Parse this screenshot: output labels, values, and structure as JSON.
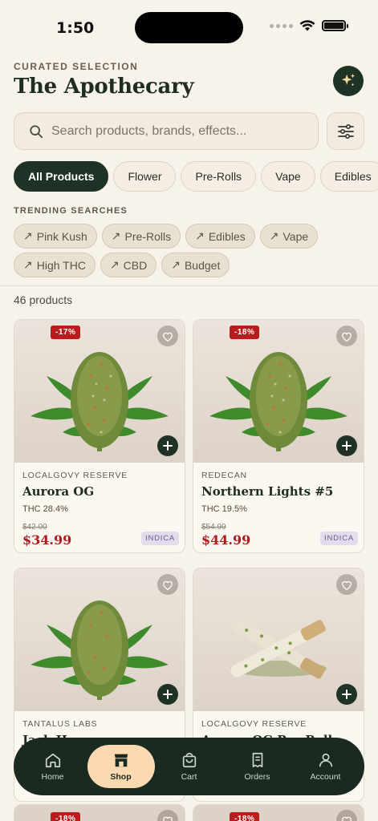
{
  "status": {
    "time": "1:50"
  },
  "header": {
    "eyebrow": "CURATED SELECTION",
    "title": "The Apothecary"
  },
  "search": {
    "placeholder": "Search products, brands, effects..."
  },
  "categories": [
    {
      "label": "All Products",
      "active": true
    },
    {
      "label": "Flower"
    },
    {
      "label": "Pre-Rolls"
    },
    {
      "label": "Vape"
    },
    {
      "label": "Edibles"
    }
  ],
  "trending": {
    "label": "TRENDING SEARCHES",
    "items": [
      "Pink Kush",
      "Pre-Rolls",
      "Edibles",
      "Vape",
      "High THC",
      "CBD",
      "Budget"
    ]
  },
  "results": {
    "count_label": "46 products"
  },
  "products": [
    {
      "discount": "-17%",
      "brand": "LOCALGOVY RESERVE",
      "name": "Aurora OG",
      "thc": "THC 28.4%",
      "old_price": "$42.00",
      "price": "$34.99",
      "strain": "INDICA",
      "image": "cannabis-bud"
    },
    {
      "discount": "-18%",
      "brand": "REDECAN",
      "name": "Northern Lights #5",
      "thc": "THC 19.5%",
      "old_price": "$54.99",
      "price": "$44.99",
      "strain": "INDICA",
      "image": "cannabis-bud"
    },
    {
      "discount": "",
      "brand": "TANTALUS LABS",
      "name": "Jack Herer",
      "thc": "",
      "old_price": "",
      "price": "",
      "strain": "",
      "image": "cannabis-bud"
    },
    {
      "discount": "",
      "brand": "LOCALGOVY RESERVE",
      "name": "Aurora OG Pre-Roll",
      "thc": "",
      "old_price": "",
      "price": "",
      "strain": "",
      "image": "pre-roll"
    }
  ],
  "peek": [
    {
      "discount": "-18%"
    },
    {
      "discount": "-18%"
    }
  ],
  "tabbar": {
    "items": [
      {
        "label": "Home",
        "icon": "home-icon"
      },
      {
        "label": "Shop",
        "icon": "shop-icon",
        "active": true
      },
      {
        "label": "Cart",
        "icon": "bag-icon"
      },
      {
        "label": "Orders",
        "icon": "receipt-icon"
      },
      {
        "label": "Account",
        "icon": "user-icon"
      }
    ]
  },
  "colors": {
    "brand_dark": "#1e3225",
    "sale_red": "#b91c1c",
    "tab_active": "#fcd9b0",
    "background": "#f8f3ea"
  }
}
